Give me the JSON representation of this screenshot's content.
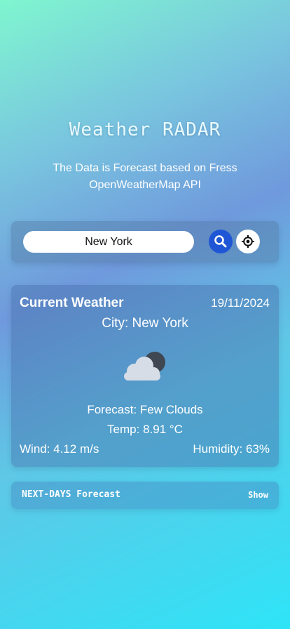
{
  "header": {
    "title": "Weather RADAR",
    "subtitle": "The Data is Forecast based on Fress OpenWeatherMap API"
  },
  "search": {
    "value": "New York",
    "search_icon": "search-icon",
    "locate_icon": "location-crosshair-icon"
  },
  "current": {
    "title": "Current Weather",
    "date": "19/11/2024",
    "city": "City: New York",
    "icon": "few-clouds-icon",
    "forecast": "Forecast: Few Clouds",
    "temp": "Temp: 8.91 °C",
    "wind": "Wind: 4.12 m/s",
    "humidity": "Humidity: 63%"
  },
  "next_days": {
    "label": "NEXT-DAYS Forecast",
    "toggle_label": "Show"
  },
  "colors": {
    "search_button": "#1f56d6",
    "locate_button": "#ffffff",
    "background_top": "#7ff6cf",
    "background_bottom": "#2ee4f7"
  }
}
